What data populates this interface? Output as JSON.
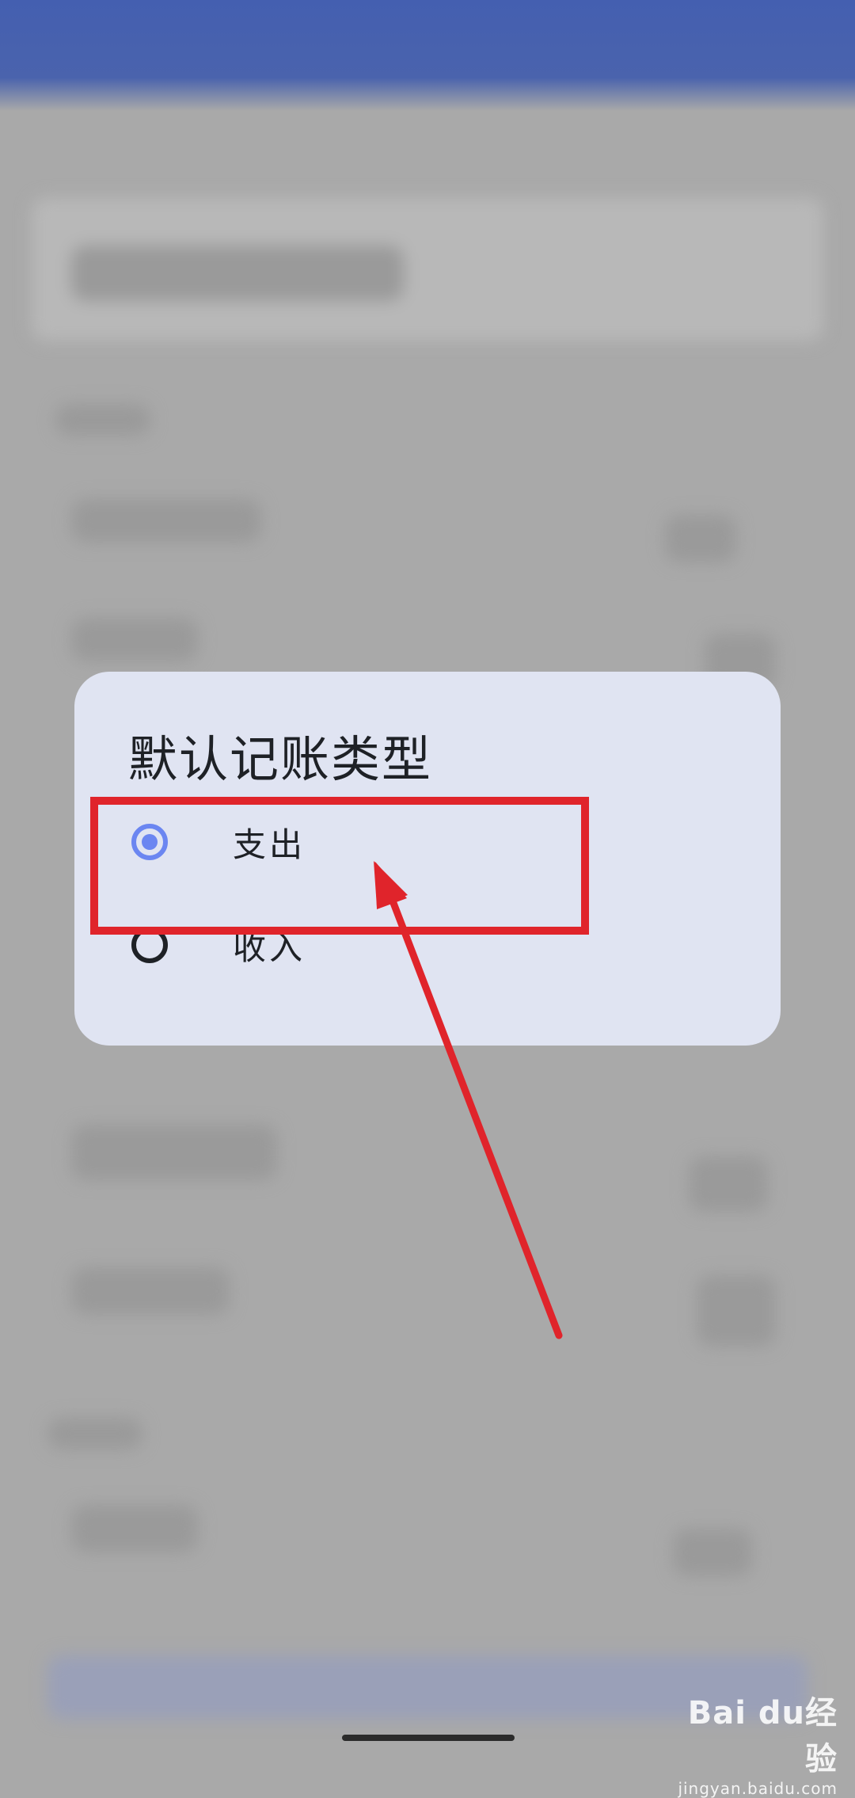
{
  "dialog": {
    "title": "默认记账类型",
    "options": [
      {
        "label": "支出",
        "selected": true
      },
      {
        "label": "收入",
        "selected": false
      }
    ]
  },
  "colors": {
    "accent": "#6b86f1",
    "annotation": "#e0242b",
    "app_bar": "#445fb0"
  },
  "watermark": {
    "logo": "Bai du经验",
    "site": "jingyan.baidu.com"
  }
}
